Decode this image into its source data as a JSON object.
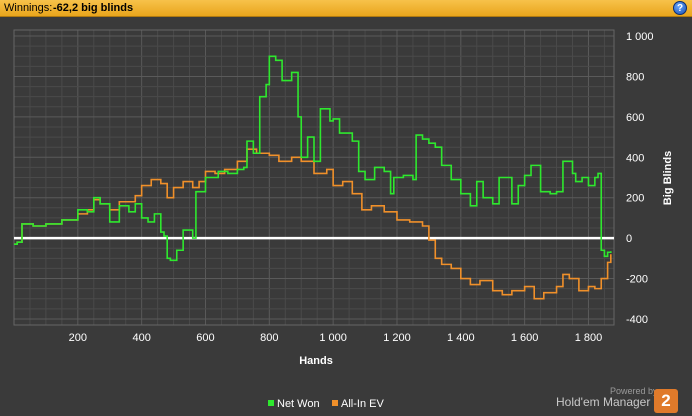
{
  "header": {
    "label": "Winnings:",
    "value": "-62,2 big blinds",
    "help_icon": "question-icon",
    "help_glyph": "?"
  },
  "brand": {
    "powered": "Powered by",
    "name": "Hold'em Manager",
    "logo": "2"
  },
  "chart_data": {
    "type": "line",
    "xlabel": "Hands",
    "ylabel": "Big Blinds",
    "xlim": [
      0,
      1880
    ],
    "ylim": [
      -430,
      1030
    ],
    "xticks": [
      200,
      400,
      600,
      800,
      1000,
      1200,
      1400,
      1600,
      1800
    ],
    "xtick_labels": [
      "200",
      "400",
      "600",
      "800",
      "1 000",
      "1 200",
      "1 400",
      "1 600",
      "1 800"
    ],
    "yticks": [
      1000,
      800,
      600,
      400,
      200,
      0,
      -200,
      -400
    ],
    "ytick_labels": [
      "1 000",
      "800",
      "600",
      "400",
      "200",
      "0",
      "-200",
      "-400"
    ],
    "grid": true,
    "legend": "bottom-center",
    "zero_line": true,
    "series": [
      {
        "name": "Net Won",
        "color": "#2ee82e",
        "x": [
          0,
          10,
          25,
          60,
          100,
          150,
          200,
          230,
          250,
          270,
          300,
          330,
          360,
          380,
          400,
          420,
          440,
          460,
          470,
          480,
          490,
          510,
          530,
          560,
          570,
          600,
          640,
          670,
          700,
          720,
          730,
          750,
          770,
          790,
          800,
          820,
          840,
          870,
          890,
          900,
          920,
          940,
          960,
          990,
          1000,
          1020,
          1060,
          1080,
          1100,
          1130,
          1160,
          1180,
          1190,
          1220,
          1250,
          1260,
          1280,
          1300,
          1320,
          1340,
          1370,
          1400,
          1430,
          1450,
          1470,
          1500,
          1520,
          1560,
          1580,
          1600,
          1620,
          1650,
          1680,
          1700,
          1720,
          1750,
          1760,
          1780,
          1800,
          1820,
          1830,
          1840,
          1850,
          1860,
          1870
        ],
        "y": [
          -30,
          -20,
          70,
          60,
          70,
          90,
          140,
          130,
          200,
          170,
          80,
          160,
          130,
          170,
          100,
          80,
          120,
          30,
          10,
          -100,
          -110,
          -60,
          40,
          0,
          230,
          300,
          330,
          320,
          340,
          350,
          480,
          420,
          700,
          760,
          900,
          880,
          780,
          820,
          600,
          400,
          500,
          380,
          640,
          580,
          590,
          520,
          480,
          330,
          290,
          350,
          330,
          220,
          300,
          310,
          290,
          510,
          490,
          470,
          450,
          360,
          290,
          220,
          160,
          280,
          200,
          170,
          300,
          170,
          260,
          310,
          360,
          230,
          220,
          230,
          380,
          320,
          280,
          300,
          260,
          300,
          320,
          -60,
          -90,
          -70,
          -65
        ]
      },
      {
        "name": "All-In EV",
        "color": "#f0902a",
        "x": [
          0,
          10,
          25,
          60,
          100,
          150,
          200,
          230,
          250,
          270,
          300,
          330,
          380,
          400,
          430,
          460,
          480,
          500,
          530,
          560,
          580,
          600,
          630,
          660,
          700,
          730,
          760,
          800,
          830,
          870,
          900,
          940,
          980,
          1000,
          1030,
          1060,
          1090,
          1120,
          1160,
          1200,
          1240,
          1280,
          1300,
          1320,
          1340,
          1370,
          1400,
          1430,
          1460,
          1500,
          1530,
          1560,
          1600,
          1630,
          1660,
          1700,
          1720,
          1740,
          1770,
          1800,
          1820,
          1840,
          1860,
          1870
        ],
        "y": [
          -30,
          -20,
          70,
          60,
          70,
          90,
          120,
          140,
          190,
          170,
          140,
          180,
          210,
          260,
          290,
          270,
          200,
          250,
          280,
          250,
          280,
          330,
          320,
          340,
          380,
          440,
          420,
          410,
          380,
          400,
          380,
          320,
          340,
          260,
          280,
          220,
          140,
          160,
          130,
          90,
          80,
          60,
          -10,
          -100,
          -130,
          -150,
          -200,
          -230,
          -210,
          -260,
          -280,
          -260,
          -240,
          -300,
          -270,
          -240,
          -180,
          -200,
          -260,
          -240,
          -250,
          -200,
          -120,
          -80
        ]
      }
    ]
  }
}
